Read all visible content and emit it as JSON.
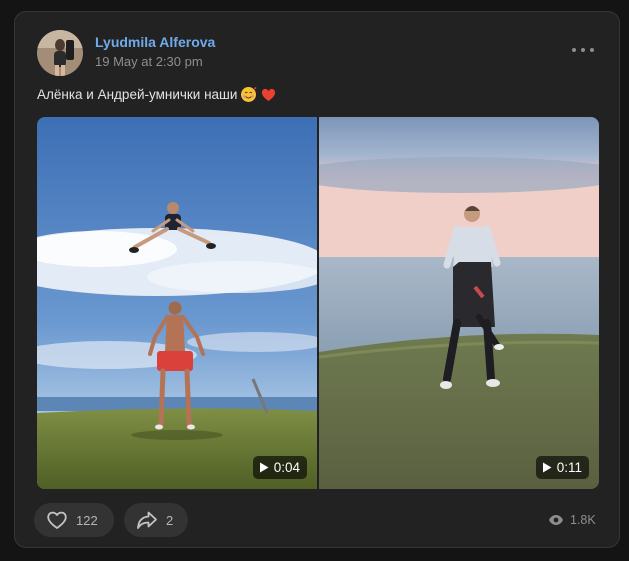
{
  "post": {
    "author": "Lyudmila Alferova",
    "timestamp": "19 May at 2:30 pm",
    "text": "Алёнка и Андрей-умнички наши"
  },
  "videos": [
    {
      "duration": "0:04"
    },
    {
      "duration": "0:11"
    }
  ],
  "actions": {
    "likes": "122",
    "shares": "2",
    "views": "1.8K"
  },
  "colors": {
    "background": "#141414",
    "card": "#222222",
    "author_link": "#71aaeb",
    "secondary_text": "#8e8e8e"
  },
  "icons": [
    "avatar-photo",
    "more-dots-icon",
    "smiling-face-with-hearts-emoji",
    "red-heart-emoji",
    "play-icon",
    "heart-icon",
    "share-arrow-icon",
    "eye-icon"
  ]
}
